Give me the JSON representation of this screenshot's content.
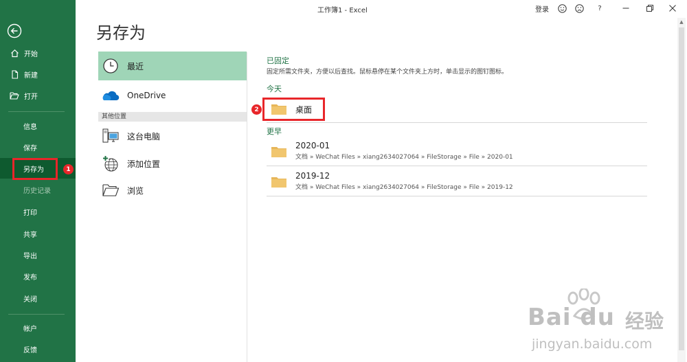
{
  "titlebar": {
    "title": "工作簿1 - Excel",
    "login_label": "登录",
    "help_label": "?"
  },
  "sidebar": {
    "items_top": [
      {
        "label": "开始",
        "icon": "home-icon"
      },
      {
        "label": "新建",
        "icon": "new-document-icon"
      },
      {
        "label": "打开",
        "icon": "open-folder-icon"
      }
    ],
    "items_mid": [
      {
        "label": "信息"
      },
      {
        "label": "保存"
      },
      {
        "label": "另存为",
        "active": true
      },
      {
        "label": "历史记录",
        "disabled": true
      },
      {
        "label": "打印"
      },
      {
        "label": "共享"
      },
      {
        "label": "导出"
      },
      {
        "label": "发布"
      },
      {
        "label": "关闭"
      }
    ],
    "items_bottom": [
      {
        "label": "帐户"
      },
      {
        "label": "反馈"
      }
    ]
  },
  "page_title": "另存为",
  "locations": {
    "recent_label": "最近",
    "onedrive_label": "OneDrive",
    "other_header": "其他位置",
    "this_pc_label": "这台电脑",
    "add_place_label": "添加位置",
    "browse_label": "浏览"
  },
  "right_panel": {
    "pinned_title": "已固定",
    "pinned_desc": "固定所需文件夹，方便以后查找。鼠标悬停在某个文件夹上方时，单击显示的图钉图标。",
    "today_title": "今天",
    "today_folder": "桌面",
    "earlier_title": "更早",
    "earlier_folders": [
      {
        "name": "2020-01",
        "path": "文档 » WeChat Files » xiang2634027064 » FileStorage » File » 2020-01"
      },
      {
        "name": "2019-12",
        "path": "文档 » WeChat Files » xiang2634027064 » FileStorage » File » 2019-12"
      }
    ]
  },
  "annotations": {
    "badge1": "1",
    "badge2": "2"
  },
  "colors": {
    "sidebar_bg": "#217346",
    "sidebar_active": "#0e5a2f",
    "selected_location": "#9fd5b7",
    "accent_green": "#217346",
    "annotation_red": "#e8262a",
    "folder_yellow": "#f1c66e"
  },
  "watermark": {
    "brand": "Bai du",
    "brand_cn": "经验",
    "url": "jingyan.baidu.com"
  }
}
